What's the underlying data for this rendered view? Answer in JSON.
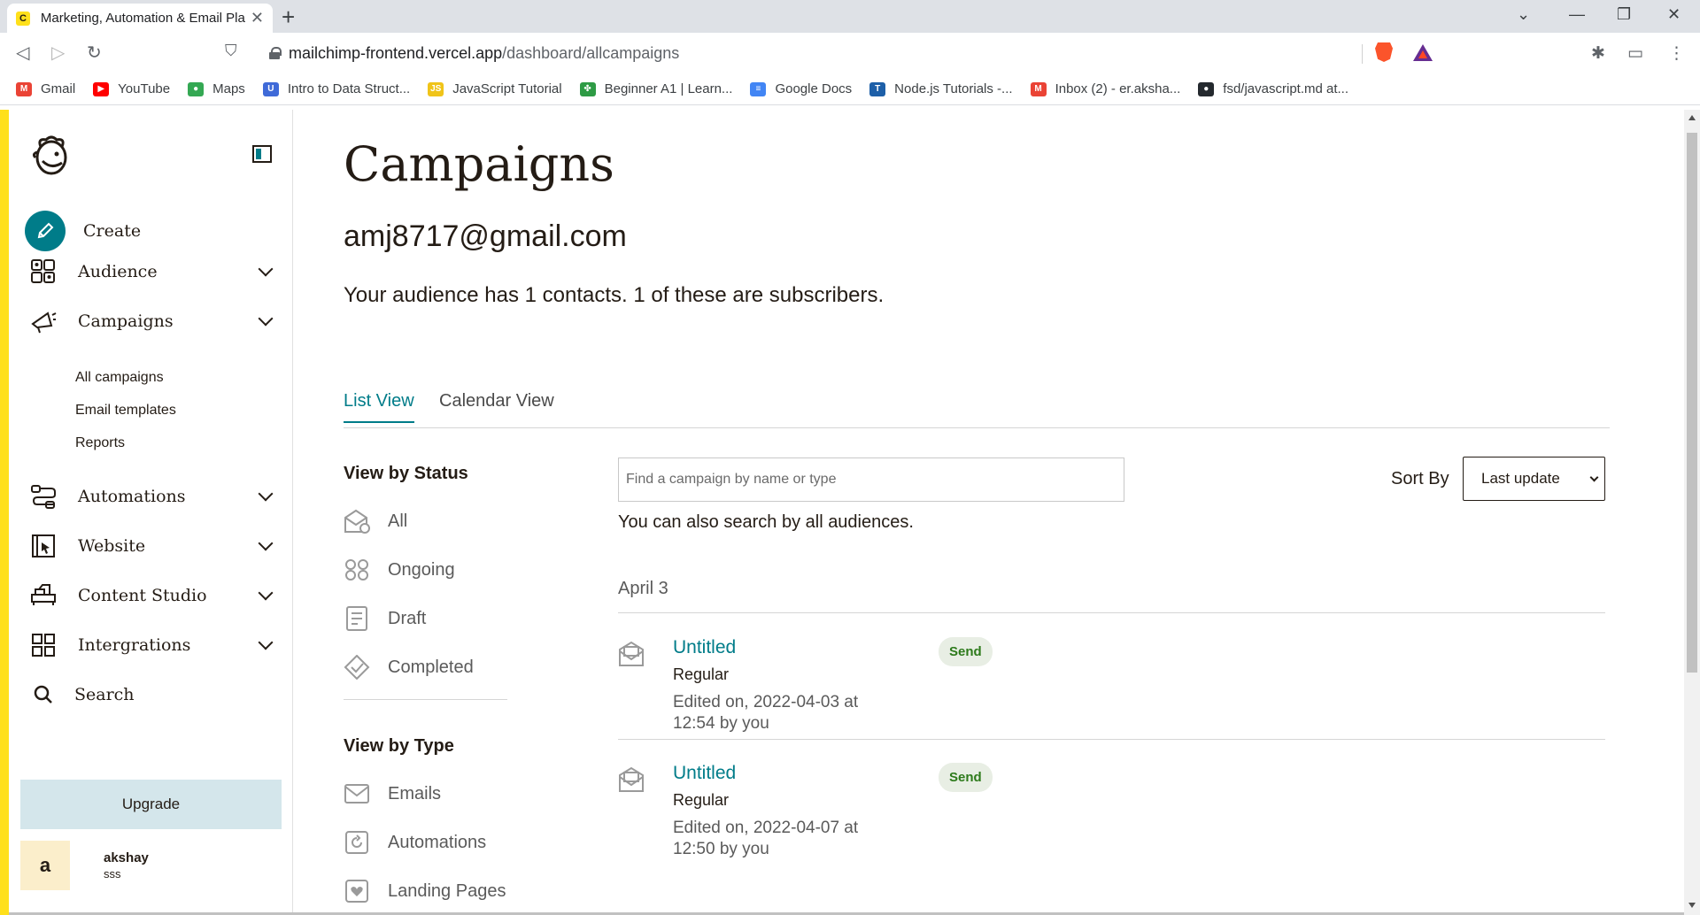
{
  "browser": {
    "tab_title": "Marketing, Automation & Email Platform",
    "url_host": "mailchimp-frontend.vercel.app",
    "url_path": "/dashboard/allcampaigns",
    "bookmarks": [
      {
        "label": "Gmail",
        "icon": "gmail-icon",
        "color": "#ea4335"
      },
      {
        "label": "YouTube",
        "icon": "youtube-icon",
        "color": "#ff0000"
      },
      {
        "label": "Maps",
        "icon": "maps-icon",
        "color": "#34a853"
      },
      {
        "label": "Intro to Data Struct...",
        "icon": "udemy-icon",
        "color": "#3f6ad8"
      },
      {
        "label": "JavaScript Tutorial",
        "icon": "js-icon",
        "color": "#f0c419"
      },
      {
        "label": "Beginner A1 | Learn...",
        "icon": "clover-icon",
        "color": "#2e9b45"
      },
      {
        "label": "Google Docs",
        "icon": "docs-icon",
        "color": "#4285f4"
      },
      {
        "label": "Node.js Tutorials -...",
        "icon": "tutorialspoint-icon",
        "color": "#1d5fa8"
      },
      {
        "label": "Inbox (2) - er.aksha...",
        "icon": "gmail-icon",
        "color": "#ea4335"
      },
      {
        "label": "fsd/javascript.md at...",
        "icon": "github-icon",
        "color": "#24292e"
      }
    ]
  },
  "sidebar": {
    "create_label": "Create",
    "items": [
      {
        "label": "Audience",
        "icon": "audience-icon"
      },
      {
        "label": "Campaigns",
        "icon": "megaphone-icon"
      },
      {
        "label": "Automations",
        "icon": "automations-icon"
      },
      {
        "label": "Website",
        "icon": "website-icon"
      },
      {
        "label": "Content Studio",
        "icon": "content-studio-icon"
      },
      {
        "label": "Intergrations",
        "icon": "integrations-icon"
      },
      {
        "label": "Search",
        "icon": "search-icon"
      }
    ],
    "campaign_subitems": [
      "All campaigns",
      "Email templates",
      "Reports"
    ],
    "upgrade_label": "Upgrade",
    "user": {
      "initial": "a",
      "name": "akshay",
      "subtitle": "sss"
    }
  },
  "main": {
    "title": "Campaigns",
    "email": "amj8717@gmail.com",
    "audience_info": "Your audience has 1 contacts. 1 of these are subscribers.",
    "tabs": [
      {
        "label": "List View",
        "active": true
      },
      {
        "label": "Calendar View",
        "active": false
      }
    ],
    "status_title": "View by Status",
    "status_filters": [
      {
        "label": "All",
        "icon": "all-icon"
      },
      {
        "label": "Ongoing",
        "icon": "ongoing-icon"
      },
      {
        "label": "Draft",
        "icon": "draft-icon"
      },
      {
        "label": "Completed",
        "icon": "completed-icon"
      }
    ],
    "type_title": "View by Type",
    "type_filters": [
      {
        "label": "Emails",
        "icon": "email-icon"
      },
      {
        "label": "Automations",
        "icon": "automation-type-icon"
      },
      {
        "label": "Landing Pages",
        "icon": "landing-page-icon"
      }
    ],
    "search_placeholder": "Find a campaign by name or type",
    "search_hint": "You can also search by all audiences.",
    "sort_label": "Sort By",
    "sort_value": "Last update",
    "date_group": "April 3",
    "campaigns": [
      {
        "name": "Untitled",
        "type": "Regular",
        "edited": "Edited on, 2022-04-03 at 12:54 by you",
        "status": "Send"
      },
      {
        "name": "Untitled",
        "type": "Regular",
        "edited": "Edited on, 2022-04-07 at 12:50 by you",
        "status": "Send"
      }
    ]
  },
  "colors": {
    "brand_yellow": "#ffe01b",
    "accent_teal": "#007c89",
    "upgrade_bg": "#d4e6eb"
  }
}
